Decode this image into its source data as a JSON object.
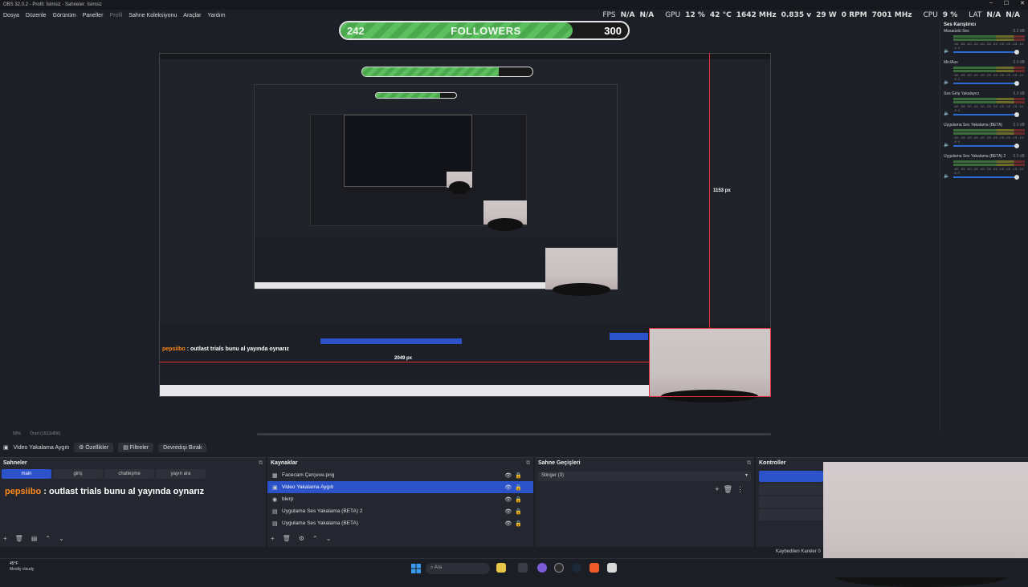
{
  "window": {
    "title": "OBS 32.0.2 - Profil: İsimsiz - Sahneler: İsimsiz"
  },
  "menu": [
    "Dosya",
    "Düzenle",
    "Görünüm",
    "Paneller",
    "Profil",
    "Sahne Koleksiyonu",
    "Araçlar",
    "Yardım"
  ],
  "stats": {
    "fps_label": "FPS",
    "fps_a": "N/A",
    "fps_b": "N/A",
    "gpu_label": "GPU",
    "gpu_usage": "12 %",
    "gpu_temp": "42 °C",
    "gpu_clock": "1642 MHz",
    "gpu_volt": "0.835 v",
    "gpu_power": "29 W",
    "gpu_fan": "0 RPM",
    "gpu_mem": "7001 MHz",
    "cpu_label": "CPU",
    "cpu_usage": "9 %",
    "lat_label": "LAT",
    "lat_a": "N/A",
    "lat_b": "N/A"
  },
  "followers_goal": {
    "current": "242",
    "label": "FOLLOWERS",
    "goal": "300",
    "progress": 0.807
  },
  "preview": {
    "height_px_label": "1153 px",
    "width_px_label": "2049 px",
    "zoom": "59%",
    "preview_label": "Önizl (1522x856)"
  },
  "mixer": {
    "title": "Ses Karıştırıcı",
    "ticks": "-60 -55 -50 -45 -40 -35 -30 -25 -20 -15 -10 -5 0",
    "channels": [
      {
        "name": "Masaüstü Ses",
        "db": "-3.2 dB"
      },
      {
        "name": "Mic/Aux",
        "db": "0.0 dB"
      },
      {
        "name": "Ses Giriş Yakalayıcı",
        "db": "0.0 dB"
      },
      {
        "name": "Uygulama Ses Yakalama (BETA)",
        "db": "0.0 dB"
      },
      {
        "name": "Uygulama Ses Yakalama (BETA) 2",
        "db": "0.0 dB"
      }
    ]
  },
  "source_toolbar": {
    "selected_source": "Video Yakalama Aygıtı",
    "properties": "Özellikler",
    "filters": "Filtreler",
    "deactivate": "Devredışı Bırak"
  },
  "scenes": {
    "title": "Sahneler",
    "tabs": [
      "main",
      "giriş",
      "chatleşme",
      "yayın ara"
    ],
    "chat_user": "pepsiibo",
    "chat_message": " : outlast trials bunu al yayında oynarız"
  },
  "sources": {
    "title": "Kaynaklar",
    "items": [
      {
        "name": "Facecam Çerçeve.png",
        "icon": "image-icon"
      },
      {
        "name": "Video Yakalama Aygıtı",
        "icon": "camera-icon"
      },
      {
        "name": "blerp",
        "icon": "globe-icon"
      },
      {
        "name": "Uygulama Ses Yakalama (BETA) 2",
        "icon": "app-audio-icon"
      },
      {
        "name": "Uygulama Ses Yakalama (BETA)",
        "icon": "app-audio-icon"
      }
    ]
  },
  "transitions": {
    "title": "Sahne Geçişleri",
    "selected": "Stinger (3)"
  },
  "controls": {
    "title": "Kontroller"
  },
  "status_bar": {
    "dropped_frames": "Kaybedilen Kareler 0"
  },
  "taskbar": {
    "temperature": "45°F",
    "weather": "Mostly cloudy",
    "search_placeholder": "Ara"
  },
  "colors": {
    "accent": "#2c52c9",
    "selection_red": "#e0303a",
    "goal_green": "#5cbf5e",
    "chat_user": "#ff8a1c"
  }
}
